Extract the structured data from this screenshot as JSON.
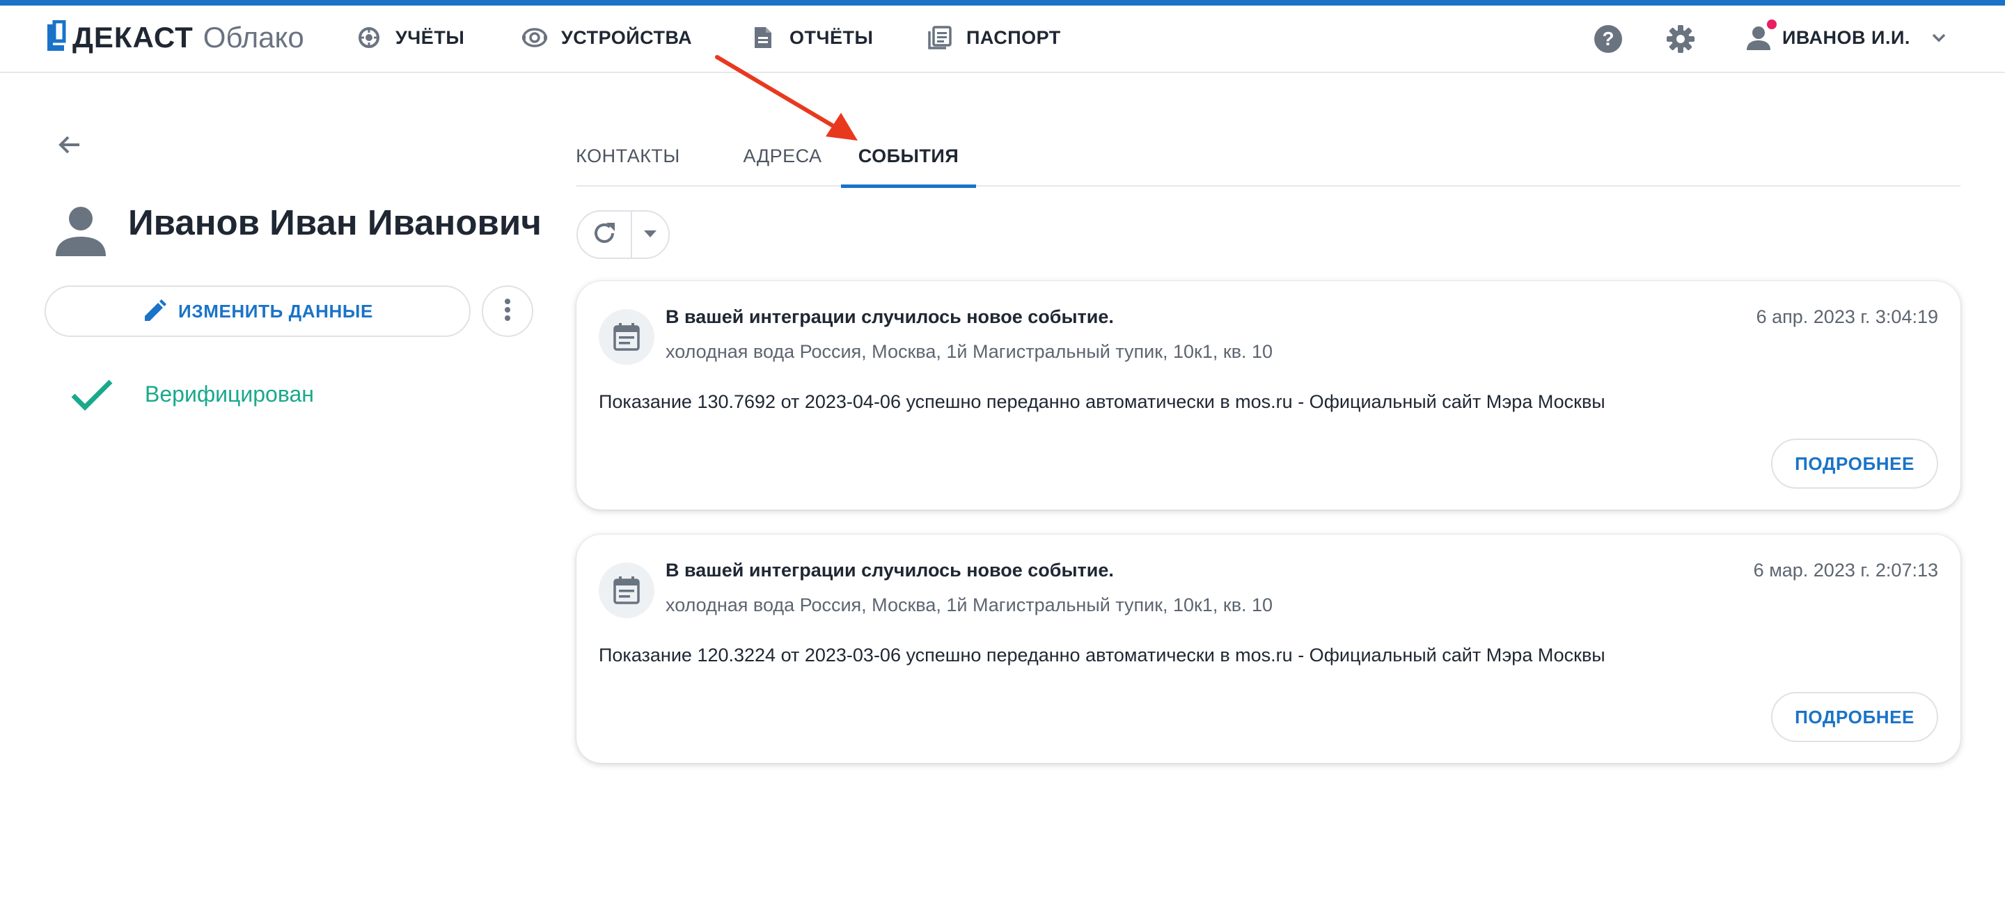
{
  "app": {
    "brand": "ДЕКАСТ",
    "product": "Облако"
  },
  "nav": [
    {
      "label": "УЧЁТЫ",
      "icon": "meter-icon"
    },
    {
      "label": "УСТРОЙСТВА",
      "icon": "device-icon"
    },
    {
      "label": "ОТЧЁТЫ",
      "icon": "document-icon"
    },
    {
      "label": "ПАСПОРТ",
      "icon": "passport-icon"
    }
  ],
  "header": {
    "help_icon": "help-icon",
    "settings_icon": "gear-icon",
    "user_name": "ИВАНОВ И.И."
  },
  "profile": {
    "name": "Иванов Иван Иванович",
    "edit_label": "ИЗМЕНИТЬ ДАННЫЕ",
    "verified_label": "Верифицирован"
  },
  "tabs": [
    {
      "label": "КОНТАКТЫ",
      "active": false
    },
    {
      "label": "АДРЕСА",
      "active": false
    },
    {
      "label": "СОБЫТИЯ",
      "active": true
    }
  ],
  "events": [
    {
      "title": "В вашей интеграции случилось новое событие.",
      "subtitle": "холодная вода Россия, Москва, 1й Магистральный тупик, 10к1, кв. 10",
      "date": "6 апр. 2023 г. 3:04:19",
      "body": "Показание 130.7692 от 2023-04-06 успешно переданно автоматически в mos.ru - Официальный сайт Мэра Москвы",
      "more_label": "ПОДРОБНЕЕ"
    },
    {
      "title": "В вашей интеграции случилось новое событие.",
      "subtitle": "холодная вода Россия, Москва, 1й Магистральный тупик, 10к1, кв. 10",
      "date": "6 мар. 2023 г. 2:07:13",
      "body": "Показание 120.3224 от 2023-03-06 успешно переданно автоматически в mos.ru - Официальный сайт Мэра Москвы",
      "more_label": "ПОДРОБНЕЕ"
    }
  ],
  "colors": {
    "accent": "#1a73c8",
    "verified": "#19a98c",
    "annotation": "#e8391f",
    "notification_dot": "#e91e63"
  }
}
